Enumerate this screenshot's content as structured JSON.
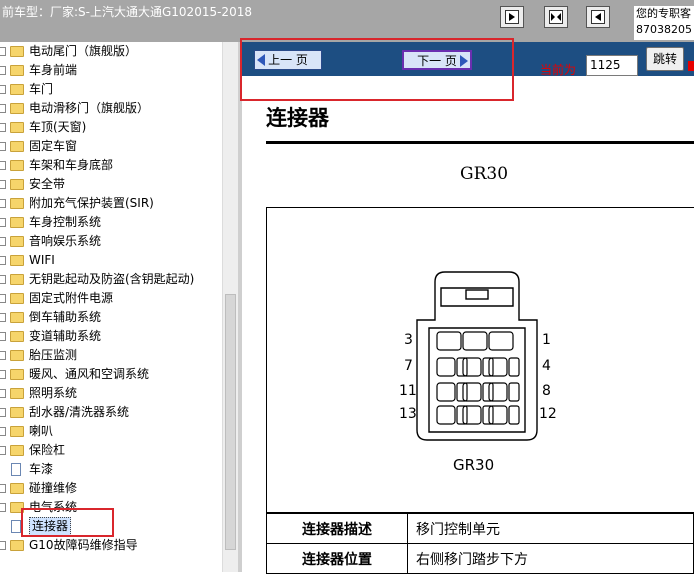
{
  "header": {
    "title": "前车型：厂家:S-上汽大通大通G102015-2018",
    "contact_line1": "您的专职客",
    "contact_line2": "87038205"
  },
  "toolbar": {
    "buttons": [
      {
        "name": "view-left-icon"
      },
      {
        "name": "view-split-icon"
      },
      {
        "name": "view-right-icon"
      }
    ]
  },
  "sidebar": {
    "items": [
      {
        "label": "电动尾门（旗舰版）",
        "icon": "folder-icon"
      },
      {
        "label": "车身前端",
        "icon": "folder-icon"
      },
      {
        "label": "车门",
        "icon": "folder-icon"
      },
      {
        "label": "电动滑移门（旗舰版）",
        "icon": "folder-icon"
      },
      {
        "label": "车顶(天窗)",
        "icon": "folder-icon"
      },
      {
        "label": "固定车窗",
        "icon": "folder-icon"
      },
      {
        "label": "车架和车身底部",
        "icon": "folder-icon"
      },
      {
        "label": "安全带",
        "icon": "folder-icon"
      },
      {
        "label": "附加充气保护装置(SIR)",
        "icon": "folder-icon"
      },
      {
        "label": "车身控制系统",
        "icon": "folder-icon"
      },
      {
        "label": "音响娱乐系统",
        "icon": "folder-icon"
      },
      {
        "label": "WIFI",
        "icon": "folder-icon"
      },
      {
        "label": "无钥匙起动及防盗(含钥匙起动)",
        "icon": "folder-icon"
      },
      {
        "label": "固定式附件电源",
        "icon": "folder-icon"
      },
      {
        "label": "倒车辅助系统",
        "icon": "folder-icon"
      },
      {
        "label": "变道辅助系统",
        "icon": "folder-icon"
      },
      {
        "label": "胎压监测",
        "icon": "folder-icon"
      },
      {
        "label": "暖风、通风和空调系统",
        "icon": "folder-icon"
      },
      {
        "label": "照明系统",
        "icon": "folder-icon"
      },
      {
        "label": "刮水器/清洗器系统",
        "icon": "folder-icon"
      },
      {
        "label": "喇叭",
        "icon": "folder-icon"
      },
      {
        "label": "保险杠",
        "icon": "folder-icon"
      },
      {
        "label": "车漆",
        "icon": "document-icon"
      },
      {
        "label": "碰撞维修",
        "icon": "folder-icon"
      },
      {
        "label": "电气系统",
        "icon": "folder-icon"
      },
      {
        "label": "连接器",
        "icon": "document-icon",
        "selected": true
      },
      {
        "label": "G10故障码维修指导",
        "icon": "folder-icon"
      }
    ]
  },
  "nav": {
    "prev_label": "上一 页",
    "next_label": "下一 页",
    "current_label": "当前为",
    "page_value": "1125",
    "jump_label": "跳转"
  },
  "document": {
    "section_title": "连接器",
    "connector_code": "GR30",
    "diagram_label": "GR30",
    "pins_left": [
      "3",
      "7",
      "11",
      "13"
    ],
    "pins_right": [
      "1",
      "4",
      "8",
      "12"
    ],
    "table": [
      {
        "key": "连接器描述",
        "value": "移门控制单元"
      },
      {
        "key": "连接器位置",
        "value": "右侧移门踏步下方"
      }
    ]
  },
  "colors": {
    "titlebar": "#a6a6a6",
    "navbar": "#1d4e82",
    "highlight": "#d9262c",
    "label_red": "#e60000"
  }
}
